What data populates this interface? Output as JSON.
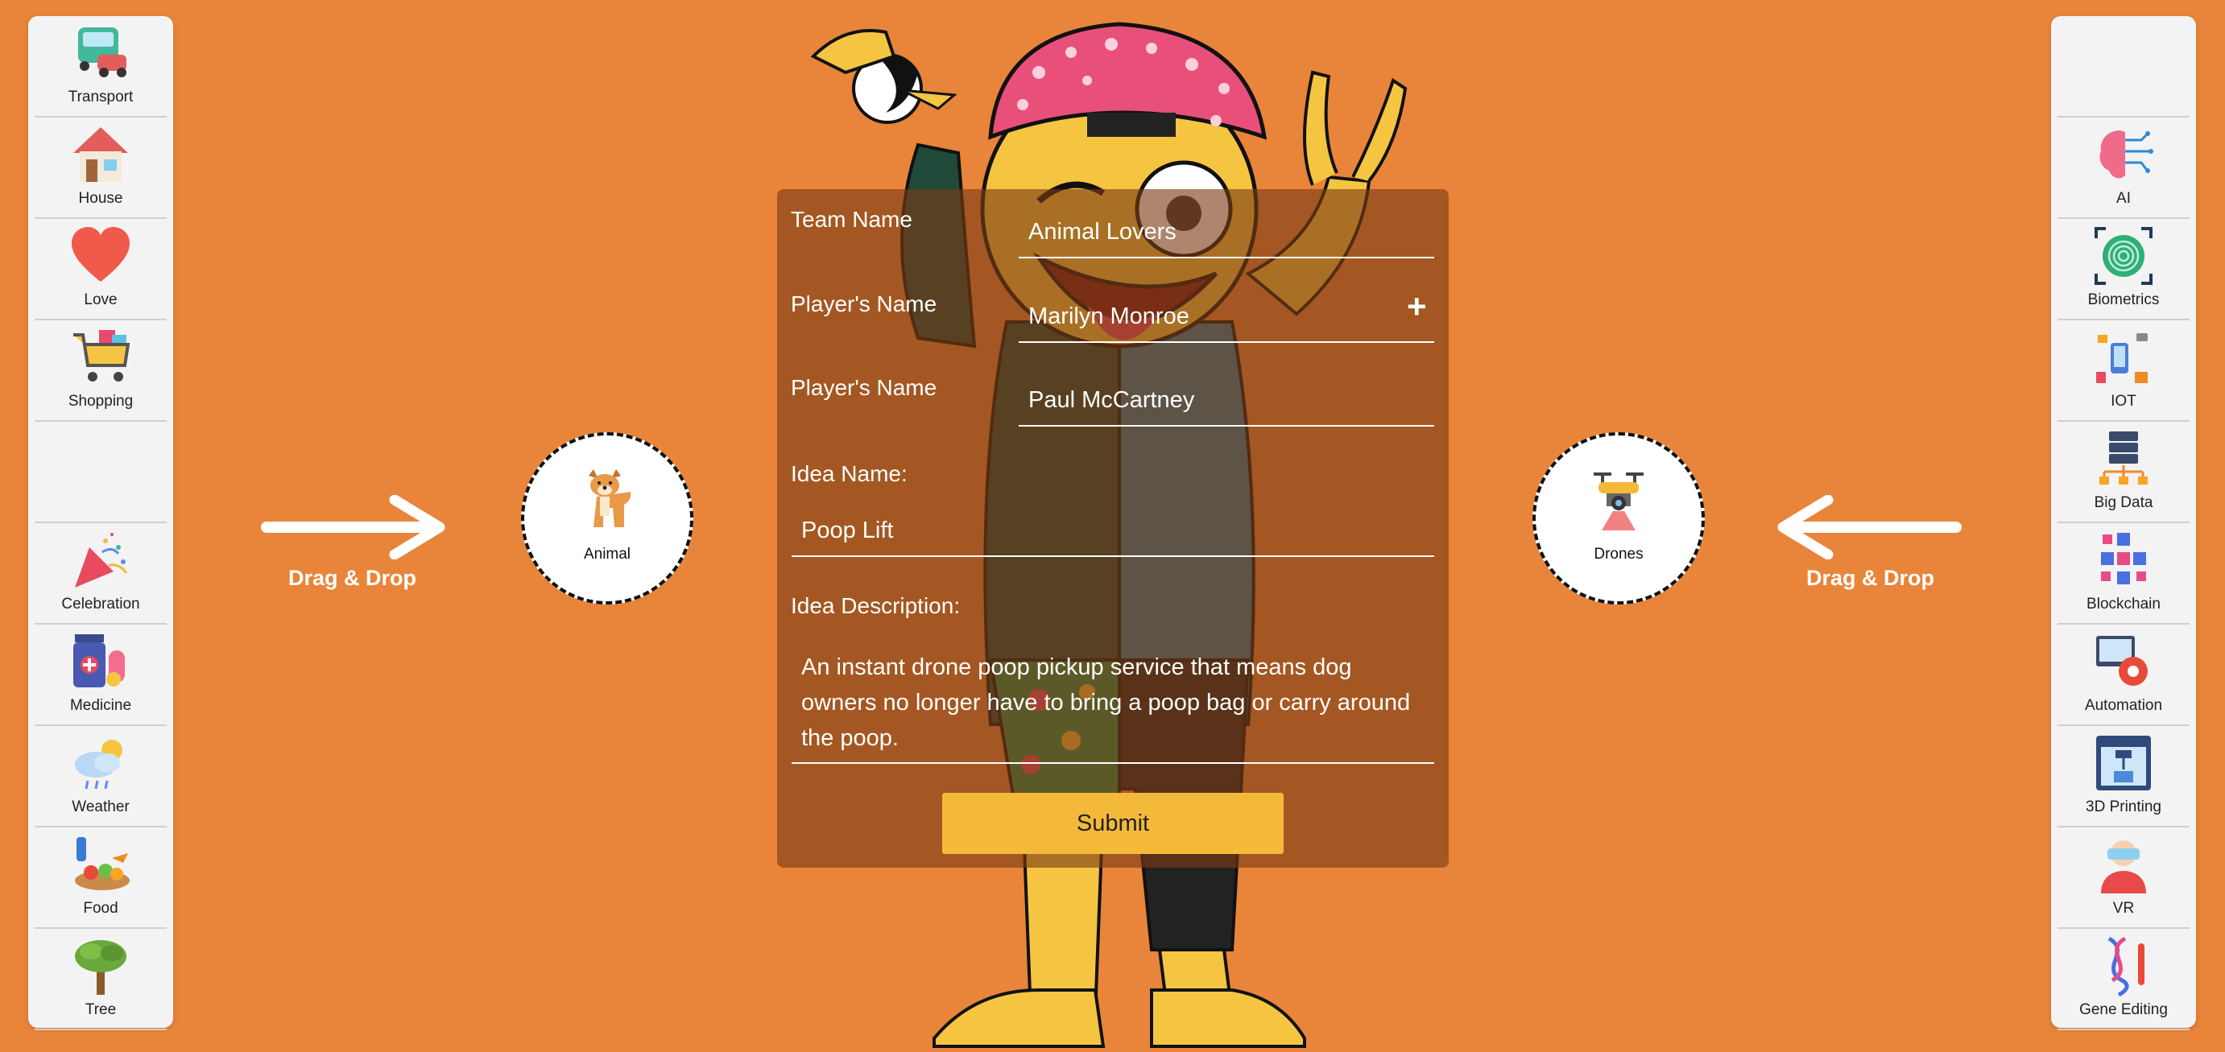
{
  "left_categories": [
    "Transport",
    "House",
    "Love",
    "Shopping",
    "",
    "Celebration",
    "Medicine",
    "Weather",
    "Food",
    "Tree"
  ],
  "right_categories": [
    "",
    "AI",
    "Biometrics",
    "IOT",
    "Big Data",
    "Blockchain",
    "Automation",
    "3D Printing",
    "VR",
    "Gene Editing"
  ],
  "drop_left": {
    "label": "Animal",
    "icon": "dog-icon"
  },
  "drop_right": {
    "label": "Drones",
    "icon": "drone-icon"
  },
  "drag_hint": "Drag & Drop",
  "form": {
    "team_label": "Team Name",
    "team_value": "Animal Lovers",
    "player_label": "Player's Name",
    "player1_value": "Marilyn Monroe",
    "player2_value": "Paul McCartney",
    "add_player": "+",
    "idea_name_label": "Idea Name:",
    "idea_name_value": "Poop Lift",
    "idea_desc_label": "Idea Description:",
    "idea_desc_value": "An instant drone poop pickup service that means dog owners no longer have to bring a poop bag or carry around the poop.",
    "submit_label": "Submit"
  },
  "colors": {
    "background": "#e8853a",
    "submit": "#f5b93a",
    "panel": "#f3f3f3"
  }
}
